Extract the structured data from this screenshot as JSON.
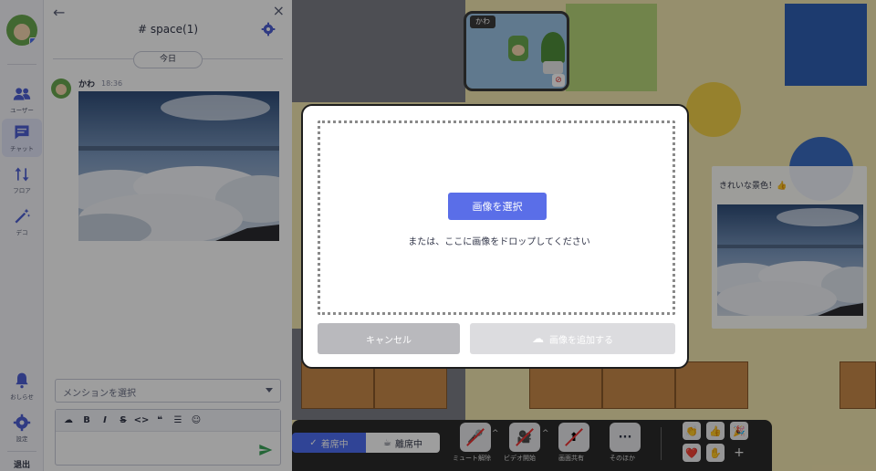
{
  "rail": {
    "items": [
      {
        "label": "ユーザー",
        "icon": "users-icon"
      },
      {
        "label": "チャット",
        "icon": "chat-icon"
      },
      {
        "label": "フロア",
        "icon": "floor-icon"
      },
      {
        "label": "デコ",
        "icon": "magic-wand-icon"
      }
    ],
    "bottom": [
      {
        "label": "おしらせ",
        "icon": "bell-icon"
      },
      {
        "label": "設定",
        "icon": "gear-icon"
      }
    ],
    "exit_label": "退出",
    "active_item": "チャット"
  },
  "chat": {
    "title": "# space(1)",
    "day_label": "今日",
    "message": {
      "author": "かわ",
      "time": "18:36",
      "attachment": "image"
    },
    "mention_placeholder": "メンションを選択",
    "toolbar": {
      "bold": "B",
      "italic": "I",
      "strike": "S",
      "code": "<>",
      "quote": "❝"
    }
  },
  "map": {
    "camera_name": "かわ",
    "side_message": "きれいな景色！👍"
  },
  "controls": {
    "status_present": "着席中",
    "status_away": "離席中",
    "buttons": [
      {
        "label": "ミュート解除",
        "icon": "mic-off-icon"
      },
      {
        "label": "ビデオ開始",
        "icon": "video-off-icon"
      },
      {
        "label": "画面共有",
        "icon": "screen-share-icon"
      },
      {
        "label": "そのほか",
        "icon": "more-icon"
      }
    ],
    "reactions": [
      "👏",
      "👍",
      "🎉",
      "❤️",
      "✋",
      "+"
    ]
  },
  "modal": {
    "select_button": "画像を選択",
    "drop_text": "または、ここに画像をドロップしてください",
    "cancel_button": "キャンセル",
    "add_button": "画像を追加する"
  },
  "colors": {
    "accent": "#5a6ee8",
    "active_status": "#4e6ef2",
    "send": "#3aa55a"
  }
}
